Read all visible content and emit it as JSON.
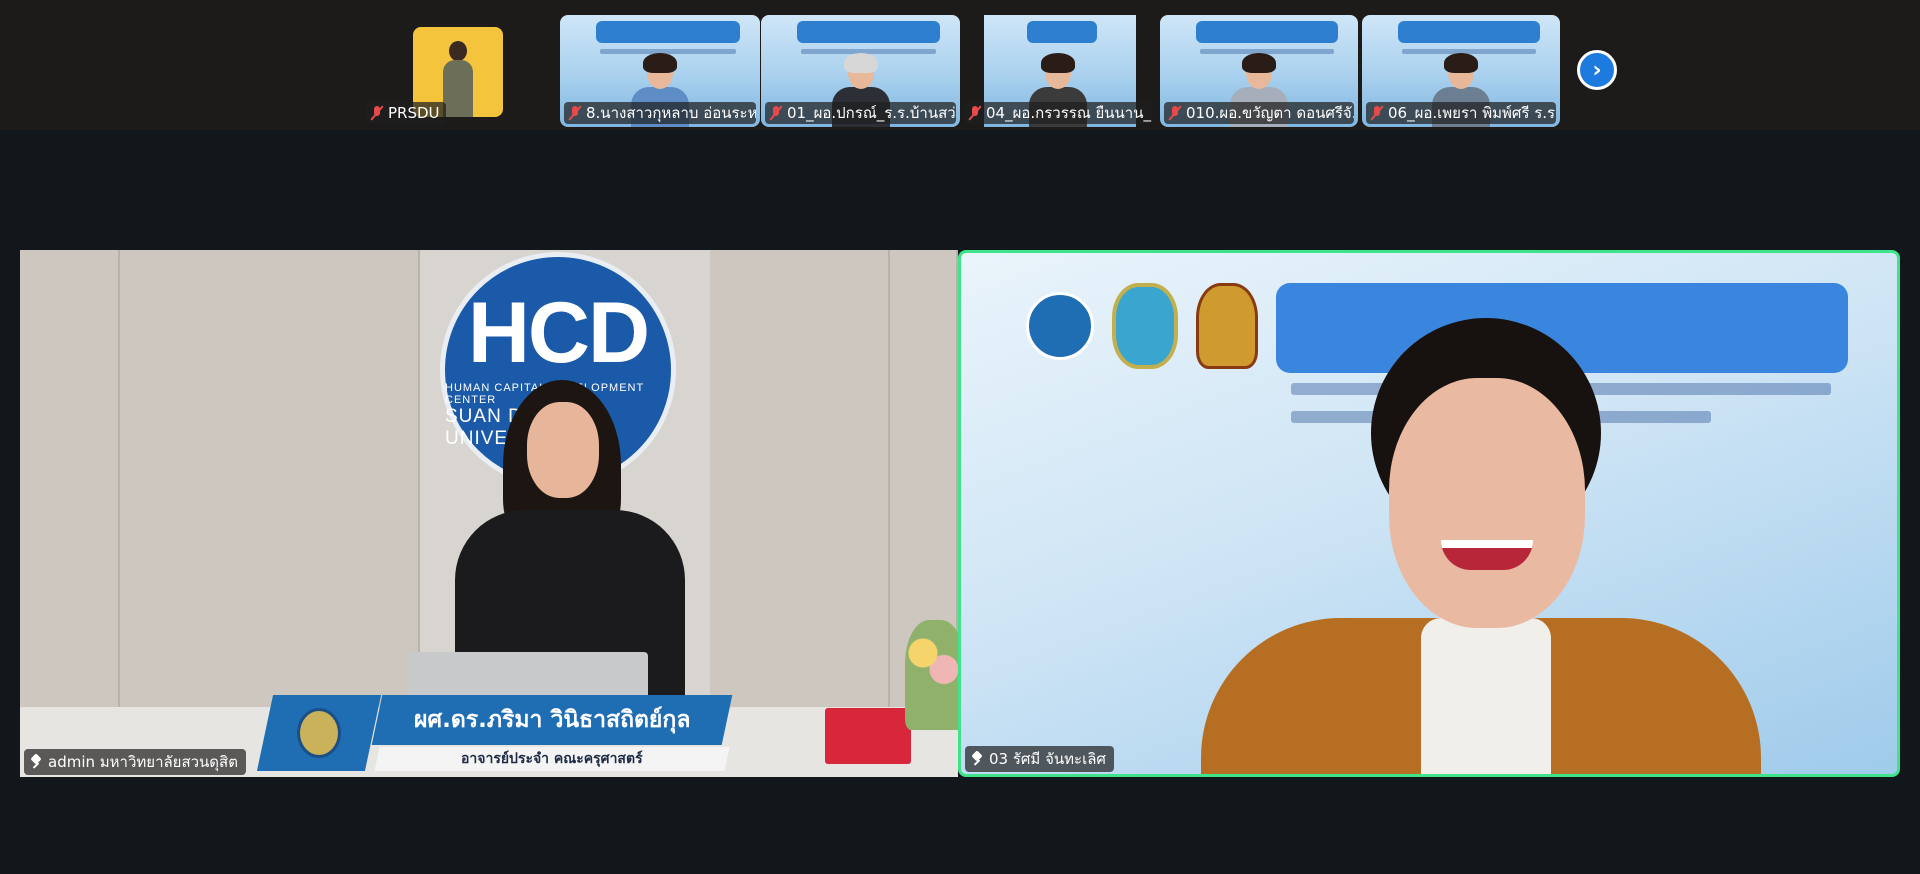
{
  "filmstrip": {
    "participants": [
      {
        "label": "PRSDU",
        "type": "avatar"
      },
      {
        "label": "8.นางสาวกุหลาบ อ่อนระหว...",
        "type": "video"
      },
      {
        "label": "01_ผอ.ปกรณ์_ร.ร.บ้านสว่า",
        "type": "video"
      },
      {
        "label": "04_ผอ.กรวรรณ ยืนนาน_...",
        "type": "video"
      },
      {
        "label": "010.ผอ.ขวัญตา ดอนศรีจั...",
        "type": "video"
      },
      {
        "label": "06_ผอ.เพยรา พิมพ์ศรี ร.ร...",
        "type": "video"
      }
    ],
    "next_icon": "chevron-right-icon"
  },
  "main": {
    "left": {
      "label": "admin มหาวิทยาลัยสวนดุสิต",
      "logo_big": "HCD",
      "logo_small": "HUMAN CAPITAL DEVELOPMENT CENTER",
      "logo_small2": "SUAN DUSIT UNIVERSITY",
      "lower_third_name": "ผศ.ดร.ภริมา วินิธาสถิตย์กุล",
      "lower_third_role": "อาจารย์ประจำ คณะครุศาสตร์"
    },
    "right": {
      "label": "03 รัศมี จันทะเลิศ",
      "active_speaker": true
    }
  },
  "colors": {
    "background": "#12171b",
    "active_border": "#3fe38a",
    "accent": "#1d7be0",
    "muted_mic": "#e84a4a"
  }
}
